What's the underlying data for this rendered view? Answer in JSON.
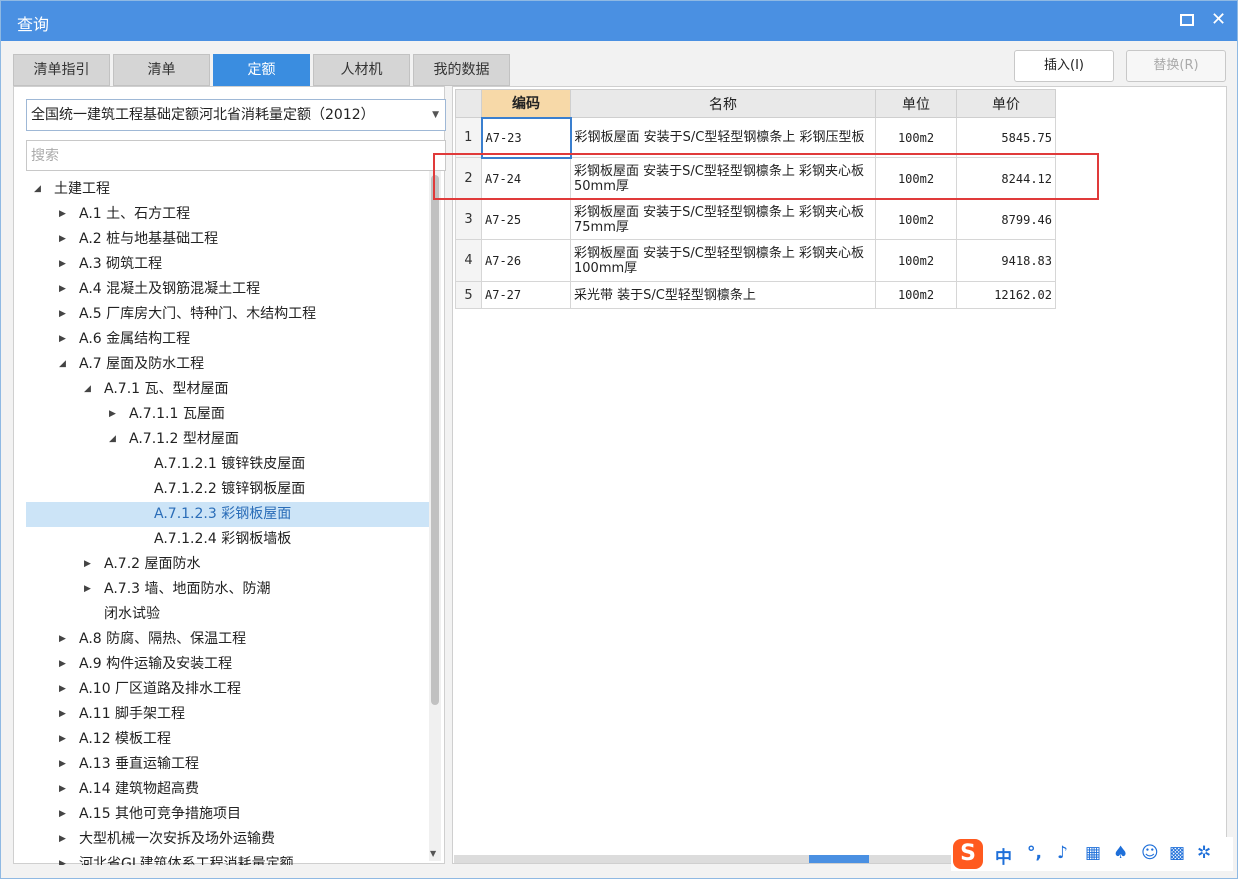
{
  "window": {
    "title": "查询"
  },
  "tabs": [
    "清单指引",
    "清单",
    "定额",
    "人材机",
    "我的数据"
  ],
  "actions": {
    "insert": "插入(I)",
    "replace": "替换(R)"
  },
  "library_select": "全国统一建筑工程基础定额河北省消耗量定额（2012）",
  "search_placeholder": "搜索",
  "tree": [
    {
      "label": "土建工程",
      "toggle": "◢"
    },
    {
      "label": "A.1 土、石方工程",
      "toggle": "▶"
    },
    {
      "label": "A.2 桩与地基基础工程",
      "toggle": "▶"
    },
    {
      "label": "A.3 砌筑工程",
      "toggle": "▶"
    },
    {
      "label": "A.4 混凝土及钢筋混凝土工程",
      "toggle": "▶"
    },
    {
      "label": "A.5 厂库房大门、特种门、木结构工程",
      "toggle": "▶"
    },
    {
      "label": "A.6 金属结构工程",
      "toggle": "▶"
    },
    {
      "label": "A.7 屋面及防水工程",
      "toggle": "◢"
    },
    {
      "label": "A.7.1 瓦、型材屋面",
      "toggle": "◢"
    },
    {
      "label": "A.7.1.1 瓦屋面",
      "toggle": "▶"
    },
    {
      "label": "A.7.1.2 型材屋面",
      "toggle": "◢"
    },
    {
      "label": "A.7.1.2.1 镀锌铁皮屋面",
      "toggle": ""
    },
    {
      "label": "A.7.1.2.2 镀锌钢板屋面",
      "toggle": ""
    },
    {
      "label": "A.7.1.2.3 彩钢板屋面",
      "toggle": ""
    },
    {
      "label": "A.7.1.2.4 彩钢板墙板",
      "toggle": ""
    },
    {
      "label": "A.7.2 屋面防水",
      "toggle": "▶"
    },
    {
      "label": "A.7.3 墙、地面防水、防潮",
      "toggle": "▶"
    },
    {
      "label": "闭水试验",
      "toggle": ""
    },
    {
      "label": "A.8 防腐、隔热、保温工程",
      "toggle": "▶"
    },
    {
      "label": "A.9 构件运输及安装工程",
      "toggle": "▶"
    },
    {
      "label": "A.10 厂区道路及排水工程",
      "toggle": "▶"
    },
    {
      "label": "A.11 脚手架工程",
      "toggle": "▶"
    },
    {
      "label": "A.12 模板工程",
      "toggle": "▶"
    },
    {
      "label": "A.13 垂直运输工程",
      "toggle": "▶"
    },
    {
      "label": "A.14 建筑物超高费",
      "toggle": "▶"
    },
    {
      "label": "A.15 其他可竞争措施项目",
      "toggle": "▶"
    },
    {
      "label": "大型机械一次安拆及场外运输费",
      "toggle": "▶"
    },
    {
      "label": "河北省GL建筑体系工程消耗量定额",
      "toggle": "▶"
    }
  ],
  "table": {
    "headers": [
      "编码",
      "名称",
      "单位",
      "单价"
    ],
    "rows": [
      {
        "num": "1",
        "code": "A7-23",
        "name": "彩钢板屋面 安装于S/C型轻型钢檩条上 彩钢压型板",
        "unit": "100m2",
        "price": "5845.75"
      },
      {
        "num": "2",
        "code": "A7-24",
        "name": "彩钢板屋面 安装于S/C型轻型钢檩条上 彩钢夹心板 50mm厚",
        "unit": "100m2",
        "price": "8244.12"
      },
      {
        "num": "3",
        "code": "A7-25",
        "name": "彩钢板屋面 安装于S/C型轻型钢檩条上 彩钢夹心板 75mm厚",
        "unit": "100m2",
        "price": "8799.46"
      },
      {
        "num": "4",
        "code": "A7-26",
        "name": "彩钢板屋面 安装于S/C型轻型钢檩条上 彩钢夹心板 100mm厚",
        "unit": "100m2",
        "price": "9418.83"
      },
      {
        "num": "5",
        "code": "A7-27",
        "name": "采光带 装于S/C型轻型钢檩条上",
        "unit": "100m2",
        "price": "12162.02"
      }
    ]
  },
  "ime": {
    "logo": "S",
    "mode": "中"
  }
}
